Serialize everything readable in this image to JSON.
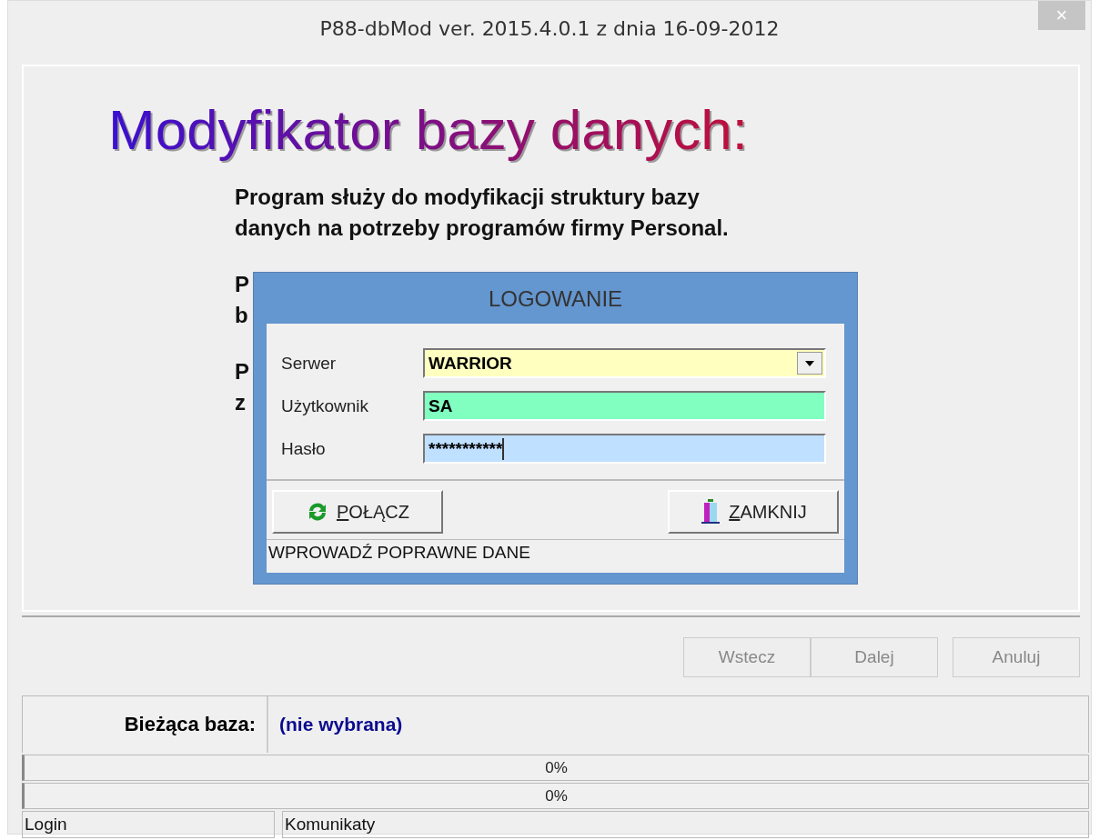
{
  "window": {
    "title": "P88-dbMod ver. 2015.4.0.1 z dnia 16-09-2012",
    "close": "×"
  },
  "heading": "Modyfikator bazy danych:",
  "paragraphs": [
    [
      "Program służy do modyfikacji struktury bazy",
      "danych na potrzeby programów firmy Personal."
    ],
    [
      "P",
      "b"
    ],
    [
      "P",
      "z"
    ]
  ],
  "dialog": {
    "title": "LOGOWANIE",
    "fields": [
      {
        "label": "Serwer",
        "value": "WARRIOR",
        "kind": "combo",
        "color": "#ffffc0"
      },
      {
        "label": "Użytkownik",
        "value": "SA",
        "kind": "text",
        "color": "#80ffc0"
      },
      {
        "label": "Hasło",
        "value": "***********",
        "kind": "password",
        "color": "#c0e0ff"
      }
    ],
    "buttons": [
      {
        "label": "POŁĄCZ",
        "kind": "connect"
      },
      {
        "label": "ZAMKNIJ",
        "kind": "close"
      }
    ],
    "status": "WPROWADŹ POPRAWNE DANE"
  },
  "nav_buttons": [
    {
      "label": "Wstecz",
      "disabled": true
    },
    {
      "label": "Dalej",
      "disabled": true
    },
    {
      "label": "Anuluj",
      "disabled": true
    }
  ],
  "current_db": {
    "label": "Bieżąca baza:",
    "value": "(nie wybrana)"
  },
  "progress": [
    {
      "level": 0,
      "reading": "0%"
    },
    {
      "level": 0,
      "reading": "0%"
    }
  ],
  "status_bar": [
    "Login",
    "Komunikaty"
  ]
}
